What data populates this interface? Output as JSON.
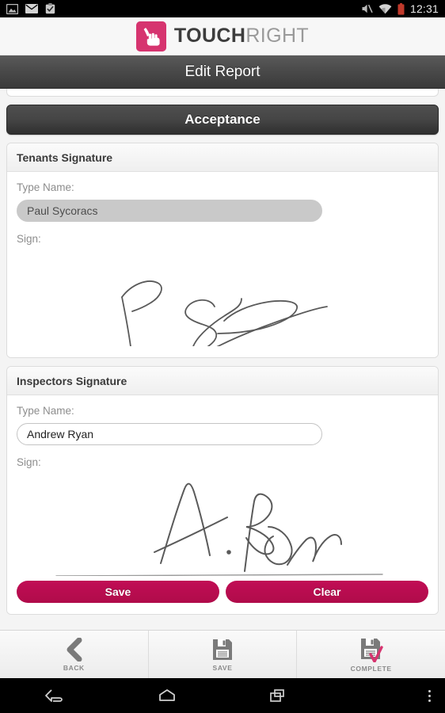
{
  "statusbar": {
    "time": "12:31",
    "icons_left": [
      "image-icon",
      "email-icon",
      "clipboard-check-icon"
    ],
    "icons_right": [
      "mute-icon",
      "wifi-icon",
      "battery-low-icon"
    ],
    "battery_color": "#c0392b"
  },
  "brand": {
    "name_bold": "TOUCH",
    "name_light": "RIGHT",
    "logo_icon": "pointing-hand-icon",
    "logo_color": "#d6346f"
  },
  "titlebar": {
    "title": "Edit Report"
  },
  "section": {
    "acceptance_label": "Acceptance"
  },
  "tenant": {
    "header": "Tenants Signature",
    "name_label": "Type Name:",
    "name_value": "Paul Sycoracs",
    "name_placeholder": "Type Name",
    "sign_label": "Sign:",
    "signature_alt": "P. Sycoracs handwritten signature"
  },
  "inspector": {
    "header": "Inspectors Signature",
    "name_label": "Type Name:",
    "name_value": "Andrew Ryan",
    "name_placeholder": "Type Name",
    "sign_label": "Sign:",
    "signature_alt": "A. Ryan handwritten signature",
    "save_label": "Save",
    "clear_label": "Clear"
  },
  "toolbar": {
    "items": [
      {
        "label": "BACK",
        "icon": "chevron-left-icon"
      },
      {
        "label": "SAVE",
        "icon": "floppy-disk-icon"
      },
      {
        "label": "COMPLETE",
        "icon": "floppy-disk-check-icon"
      }
    ],
    "accent_color": "#d6346f"
  },
  "navbar": {
    "items": [
      {
        "name": "back",
        "icon": "nav-back-icon"
      },
      {
        "name": "home",
        "icon": "nav-home-icon"
      },
      {
        "name": "recents",
        "icon": "nav-recents-icon"
      },
      {
        "name": "overflow",
        "icon": "nav-overflow-icon"
      }
    ]
  },
  "theme": {
    "accent": "#b00b4a",
    "brand_pink": "#d6346f",
    "dark_bar": "#3a3a3a"
  }
}
